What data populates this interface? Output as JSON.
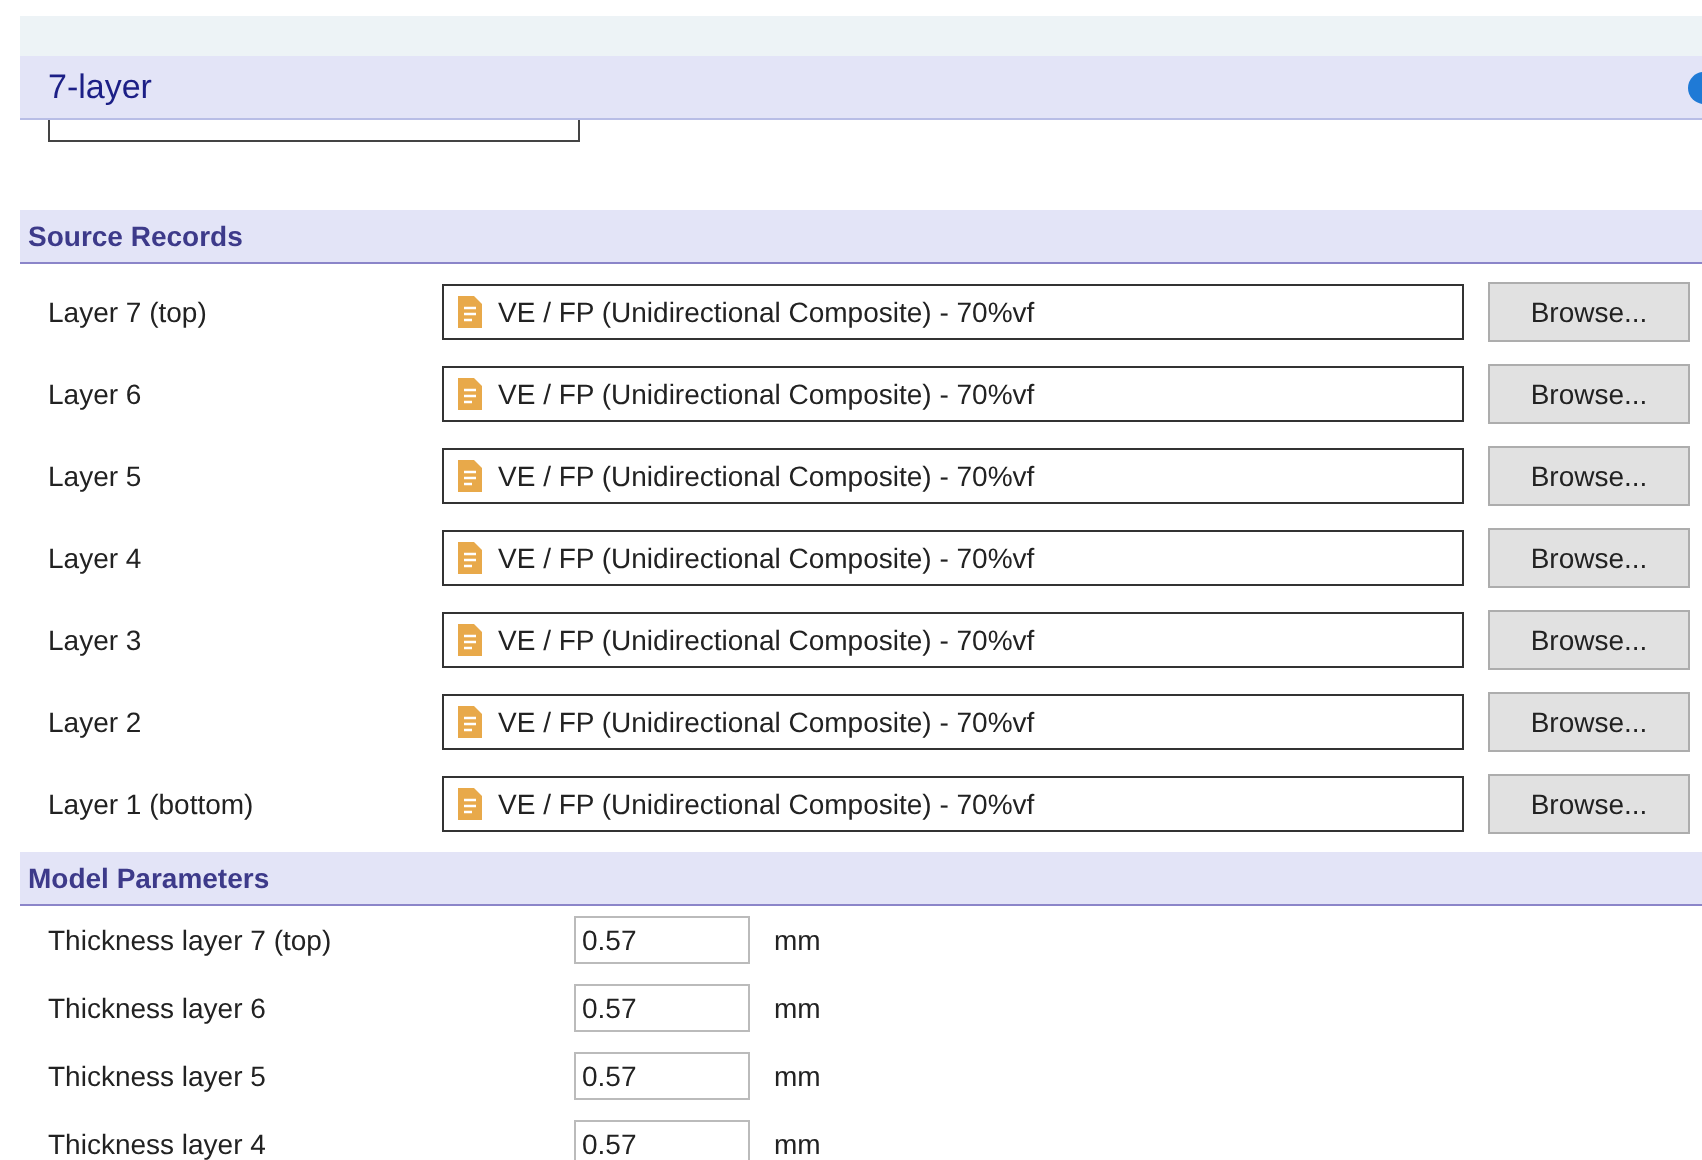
{
  "header": {
    "title": "7-layer"
  },
  "source_records": {
    "title": "Source Records",
    "rows": [
      {
        "label": "Layer 7 (top)",
        "value": "VE / FP (Unidirectional Composite) - 70%vf",
        "button": "Browse..."
      },
      {
        "label": "Layer 6",
        "value": "VE / FP (Unidirectional Composite) - 70%vf",
        "button": "Browse..."
      },
      {
        "label": "Layer 5",
        "value": "VE / FP (Unidirectional Composite) - 70%vf",
        "button": "Browse..."
      },
      {
        "label": "Layer 4",
        "value": "VE / FP (Unidirectional Composite) - 70%vf",
        "button": "Browse..."
      },
      {
        "label": "Layer 3",
        "value": "VE / FP (Unidirectional Composite) - 70%vf",
        "button": "Browse..."
      },
      {
        "label": "Layer 2",
        "value": "VE / FP (Unidirectional Composite) - 70%vf",
        "button": "Browse..."
      },
      {
        "label": "Layer 1 (bottom)",
        "value": "VE / FP (Unidirectional Composite) - 70%vf",
        "button": "Browse..."
      }
    ]
  },
  "model_parameters": {
    "title": "Model Parameters",
    "rows": [
      {
        "label": "Thickness layer 7 (top)",
        "value": "0.57",
        "unit": "mm"
      },
      {
        "label": "Thickness layer 6",
        "value": "0.57",
        "unit": "mm"
      },
      {
        "label": "Thickness layer 5",
        "value": "0.57",
        "unit": "mm"
      },
      {
        "label": "Thickness layer 4",
        "value": "0.57",
        "unit": "mm"
      }
    ]
  }
}
